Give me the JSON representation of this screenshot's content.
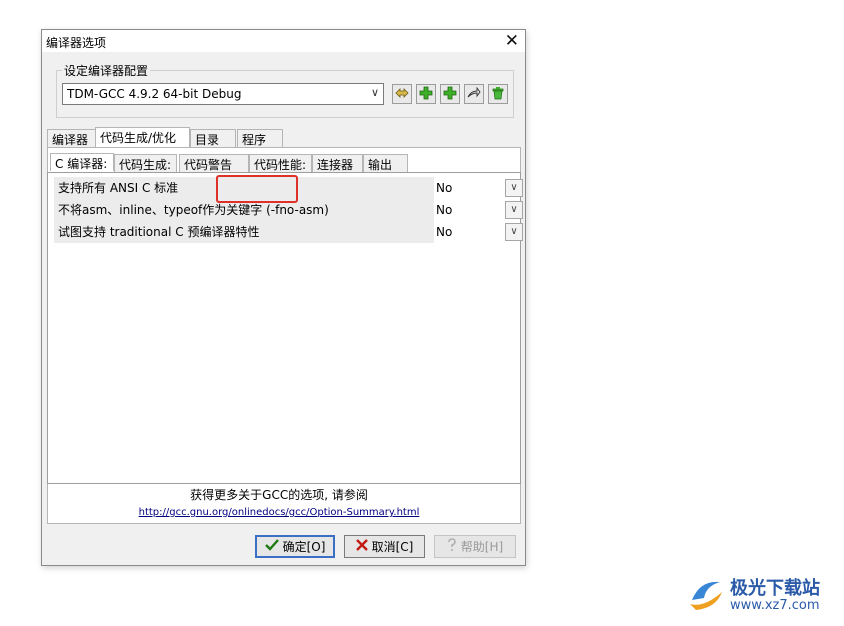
{
  "window": {
    "title": "编译器选项",
    "close_glyph": "✕"
  },
  "config": {
    "group_label": "设定编译器配置",
    "selected": "TDM-GCC 4.9.2 64-bit Debug",
    "toolbar_icons": [
      "rename-icon",
      "add-icon",
      "add-copy-icon",
      "export-icon",
      "delete-icon"
    ]
  },
  "outer_tabs": [
    "编译器",
    "代码生成/优化",
    "目录",
    "程序"
  ],
  "inner_tabs": [
    "C 编译器:",
    "代码生成:",
    "代码警告",
    "代码性能:",
    "连接器",
    "输出"
  ],
  "options": [
    {
      "label": "支持所有 ANSI C 标准",
      "value": "No"
    },
    {
      "label": "不将asm、inline、typeof作为关键字 (-fno-asm)",
      "value": "No"
    },
    {
      "label": "试图支持 traditional C 预编译器特性",
      "value": "No"
    }
  ],
  "info": {
    "text": "获得更多关于GCC的选项, 请参阅",
    "link": "http://gcc.gnu.org/onlinedocs/gcc/Option-Summary.html"
  },
  "buttons": {
    "ok": "确定[O]",
    "cancel": "取消[C]",
    "help": "帮助[H]"
  },
  "watermark": {
    "name": "极光下载站",
    "url": "www.xz7.com"
  },
  "colors": {
    "highlight": "#e0302a",
    "accent": "#3a6fc4"
  }
}
